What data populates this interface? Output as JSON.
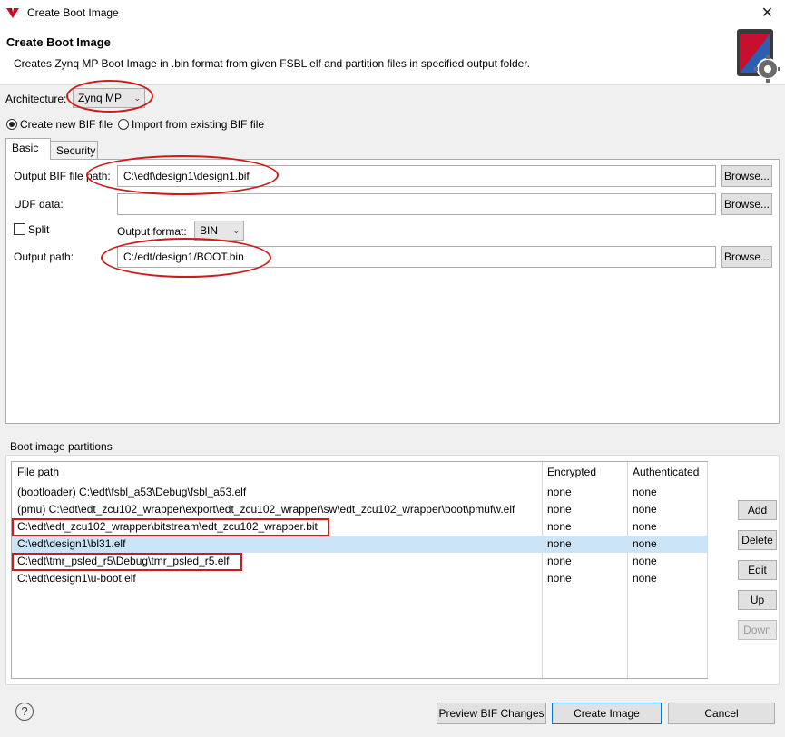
{
  "window": {
    "title": "Create Boot Image",
    "close_glyph": "✕"
  },
  "header": {
    "title": "Create Boot Image",
    "description": "Creates Zynq MP Boot Image in .bin format from given FSBL elf and partition files in specified output folder."
  },
  "architecture": {
    "label": "Architecture:",
    "value": "Zynq MP"
  },
  "bif_mode": {
    "create_new_label": "Create new BIF file",
    "import_label": "Import from existing BIF file",
    "selected": "create_new"
  },
  "tabs": [
    {
      "label": "Basic",
      "active": true
    },
    {
      "label": "Security",
      "active": false
    }
  ],
  "basic": {
    "output_bif_label": "Output BIF file path:",
    "output_bif_value": "C:\\edt\\design1\\design1.bif",
    "udf_label": "UDF data:",
    "udf_value": "",
    "split_label": "Split",
    "split_checked": false,
    "output_format_label": "Output format:",
    "output_format_value": "BIN",
    "output_path_label": "Output path:",
    "output_path_value": "C:/edt/design1/BOOT.bin",
    "browse_label": "Browse..."
  },
  "partitions": {
    "label": "Boot image partitions",
    "columns": [
      "File path",
      "Encrypted",
      "Authenticated"
    ],
    "rows": [
      {
        "path": "(bootloader) C:\\edt\\fsbl_a53\\Debug\\fsbl_a53.elf",
        "encrypted": "none",
        "authenticated": "none",
        "selected": false
      },
      {
        "path": "(pmu) C:\\edt\\edt_zcu102_wrapper\\export\\edt_zcu102_wrapper\\sw\\edt_zcu102_wrapper\\boot\\pmufw.elf",
        "encrypted": "none",
        "authenticated": "none",
        "selected": false
      },
      {
        "path": "C:\\edt\\edt_zcu102_wrapper\\bitstream\\edt_zcu102_wrapper.bit",
        "encrypted": "none",
        "authenticated": "none",
        "selected": false
      },
      {
        "path": "C:\\edt\\design1\\bl31.elf",
        "encrypted": "none",
        "authenticated": "none",
        "selected": true
      },
      {
        "path": "C:\\edt\\tmr_psled_r5\\Debug\\tmr_psled_r5.elf",
        "encrypted": "none",
        "authenticated": "none",
        "selected": false
      },
      {
        "path": "C:\\edt\\design1\\u-boot.elf",
        "encrypted": "none",
        "authenticated": "none",
        "selected": false
      }
    ],
    "buttons": {
      "add": "Add",
      "delete": "Delete",
      "edit": "Edit",
      "up": "Up",
      "down": "Down"
    }
  },
  "footer": {
    "help_glyph": "?",
    "preview_label": "Preview BIF Changes",
    "create_label": "Create Image",
    "cancel_label": "Cancel"
  },
  "colors": {
    "annotation_red": "#d01a1a",
    "selection": "#cce4f7",
    "default_button_border": "#0078d7"
  }
}
